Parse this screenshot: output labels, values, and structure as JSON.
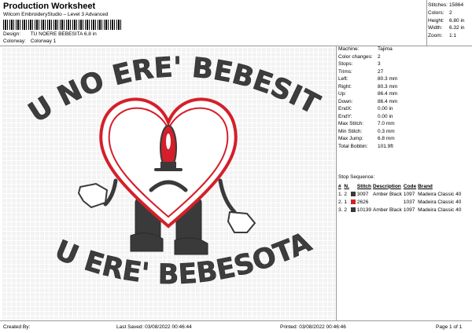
{
  "header": {
    "title": "Production Worksheet",
    "software": "Wilcom EmbroideryStudio – Level 3 Advanced",
    "design_label": "Design:",
    "design_value": "TU NOERE BEBESITA 6.8 in",
    "colorway_label": "Colorway:",
    "colorway_value": "Colorway 1"
  },
  "summary": [
    {
      "label": "Stitches:",
      "value": "15864"
    },
    {
      "label": "Colors:",
      "value": "2"
    },
    {
      "label": "Height:",
      "value": "6.80 in"
    },
    {
      "label": "Width:",
      "value": "6.32 in"
    },
    {
      "label": "Zoom:",
      "value": "1:1"
    }
  ],
  "details": [
    {
      "label": "Machine:",
      "value": "Tajima"
    },
    {
      "label": "Color changes:",
      "value": "2"
    },
    {
      "label": "Stops:",
      "value": "3"
    },
    {
      "label": "Trims:",
      "value": "27"
    },
    {
      "label": "Left:",
      "value": "80.3 mm"
    },
    {
      "label": "Right:",
      "value": "80.3 mm"
    },
    {
      "label": "Up:",
      "value": "86.4 mm"
    },
    {
      "label": "Down:",
      "value": "86.4 mm"
    },
    {
      "label": "EndX:",
      "value": "0.00 in"
    },
    {
      "label": "EndY:",
      "value": "0.00 in"
    },
    {
      "label": "Max Stitch:",
      "value": "7.0 mm"
    },
    {
      "label": "Min Stitch:",
      "value": "0.3 mm"
    },
    {
      "label": "Max Jump:",
      "value": "6.8 mm"
    },
    {
      "label": "Total Bobbin:",
      "value": "101.9ft"
    }
  ],
  "stop_sequence": {
    "title": "Stop Sequence:",
    "columns": [
      "#",
      "N.",
      "",
      "Stitch",
      "Code",
      "Description",
      "Brand"
    ],
    "rows": [
      {
        "num": "1.",
        "needle": "2",
        "color": "#3a3a3a",
        "stitches": "3097",
        "code": "1097",
        "description": "Amber Black",
        "brand": "Madeira Classic 40"
      },
      {
        "num": "2.",
        "needle": "1",
        "color": "#d3202b",
        "stitches": "2626",
        "code": "1037",
        "description": "Madeira Classic 40",
        "brand": "Madeira Classic 40"
      },
      {
        "num": "3.",
        "needle": "2",
        "color": "#3a3a3a",
        "stitches": "10139",
        "code": "1097",
        "description": "Amber Black",
        "brand": "Madeira Classic 40"
      }
    ]
  },
  "design": {
    "top_text": "TU NO ERE' BEBESITA",
    "bottom_text": "TU ERE' BEBESOTA",
    "thread_black": "#3d3d3d",
    "thread_red": "#d3202b"
  },
  "footer": {
    "created_by": "Created By:",
    "last_saved": "Last Saved: 03/08/2022 00:46:44",
    "printed": "Printed: 03/08/2022 00:46:46",
    "page": "Page 1 of 1"
  }
}
